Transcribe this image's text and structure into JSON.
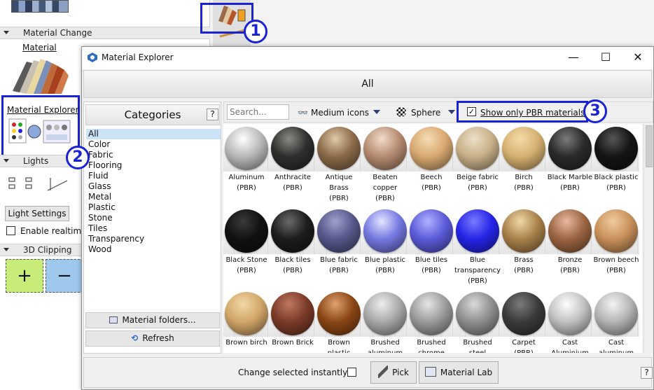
{
  "left_panel": {
    "material_change_header": "Material Change",
    "material_label": "Material",
    "material_explorer_label": "Material Explorer",
    "lights_header": "Lights",
    "light_settings_button": "Light Settings",
    "enable_realtime_label": "Enable realtime",
    "clipping_header": "3D Clipping",
    "add_symbol": "+",
    "remove_symbol": "−"
  },
  "annotations": [
    "1",
    "2",
    "3"
  ],
  "dialog": {
    "title": "Material Explorer",
    "minimize": "—",
    "maximize": "☐",
    "close": "✕",
    "all_bar": "All",
    "categories_header": "Categories",
    "help": "?",
    "categories": [
      "All",
      "Color",
      "Fabric",
      "Flooring",
      "Fluid",
      "Glass",
      "Metal",
      "Plastic",
      "Stone",
      "Tiles",
      "Transparency",
      "Wood"
    ],
    "selected_category": "All",
    "material_folders_button": "Material folders...",
    "refresh_button": "Refresh",
    "search_placeholder": "Search...",
    "icon_size": "Medium icons",
    "preview_shape": "Sphere",
    "pbr_checkbox_label": "Show only PBR materials",
    "pbr_checked": true,
    "change_instantly_label": "Change selected instantly:",
    "pick_button": "Pick",
    "material_lab_button": "Material Lab",
    "bottom_help": "?"
  },
  "materials": [
    {
      "name": "Aluminum",
      "tag": "(PBR)",
      "color": "#b8b8b8",
      "hi": "#ffffff"
    },
    {
      "name": "Anthracite",
      "tag": "(PBR)",
      "color": "#2e2e2c",
      "hi": "#8a8a86"
    },
    {
      "name": "Antique Brass",
      "tag": "(PBR)",
      "color": "#8a6a48",
      "hi": "#e0c8a8"
    },
    {
      "name": "Beaten copper",
      "tag": "(PBR)",
      "color": "#b58a70",
      "hi": "#f2dccb"
    },
    {
      "name": "Beech",
      "tag": "(PBR)",
      "color": "#d8a870",
      "hi": "#f6dcb6"
    },
    {
      "name": "Beige fabric",
      "tag": "(PBR)",
      "color": "#c8b088",
      "hi": "#ece0c8"
    },
    {
      "name": "Birch",
      "tag": "(PBR)",
      "color": "#d6b070",
      "hi": "#f4dcaa"
    },
    {
      "name": "Black Marble",
      "tag": "(PBR)",
      "color": "#2a2a2a",
      "hi": "#7a7a7a"
    },
    {
      "name": "Black plastic",
      "tag": "(PBR)",
      "color": "#141414",
      "hi": "#555555"
    },
    {
      "name": "Black Stone",
      "tag": "(PBR)",
      "color": "#111111",
      "hi": "#3a3a3a"
    },
    {
      "name": "Black tiles",
      "tag": "(PBR)",
      "color": "#1c1c1c",
      "hi": "#6a6a6a"
    },
    {
      "name": "Blue fabric",
      "tag": "(PBR)",
      "color": "#55578a",
      "hi": "#9ea0cc"
    },
    {
      "name": "Blue plastic",
      "tag": "(PBR)",
      "color": "#7478e0",
      "hi": "#e4e6ff"
    },
    {
      "name": "Blue tiles",
      "tag": "(PBR)",
      "color": "#5a5ad8",
      "hi": "#b0b2ff"
    },
    {
      "name": "Blue transparency",
      "tag": "(PBR)",
      "color": "#2424e6",
      "hi": "#7a7aff"
    },
    {
      "name": "Brass",
      "tag": "(PBR)",
      "color": "#a8804a",
      "hi": "#f0d8a8"
    },
    {
      "name": "Bronze",
      "tag": "(PBR)",
      "color": "#9a6440",
      "hi": "#e8b8a0"
    },
    {
      "name": "Brown beech",
      "tag": "(PBR)",
      "color": "#c8905a",
      "hi": "#f0cca0"
    },
    {
      "name": "Brown birch",
      "tag": "",
      "color": "#d2a668",
      "hi": "#f2d8a8"
    },
    {
      "name": "Brown Brick",
      "tag": "",
      "color": "#7a3a28",
      "hi": "#c07860"
    },
    {
      "name": "Brown plastic",
      "tag": "",
      "color": "#8a4614",
      "hi": "#e0a070"
    },
    {
      "name": "Brushed aluminum",
      "tag": "",
      "color": "#a8a8a8",
      "hi": "#eeeeee"
    },
    {
      "name": "Brushed chrome",
      "tag": "",
      "color": "#9a9a9a",
      "hi": "#e6e6e6"
    },
    {
      "name": "Brushed steel",
      "tag": "",
      "color": "#8e8e8e",
      "hi": "#dadada"
    },
    {
      "name": "Carpet",
      "tag": "(PBR)",
      "color": "#3a3a3a",
      "hi": "#7a7a7a"
    },
    {
      "name": "Cast Aluminium",
      "tag": "",
      "color": "#c0c0c0",
      "hi": "#ffffff"
    },
    {
      "name": "Cast aluminum",
      "tag": "",
      "color": "#b4b4b4",
      "hi": "#f4f4f4"
    }
  ]
}
